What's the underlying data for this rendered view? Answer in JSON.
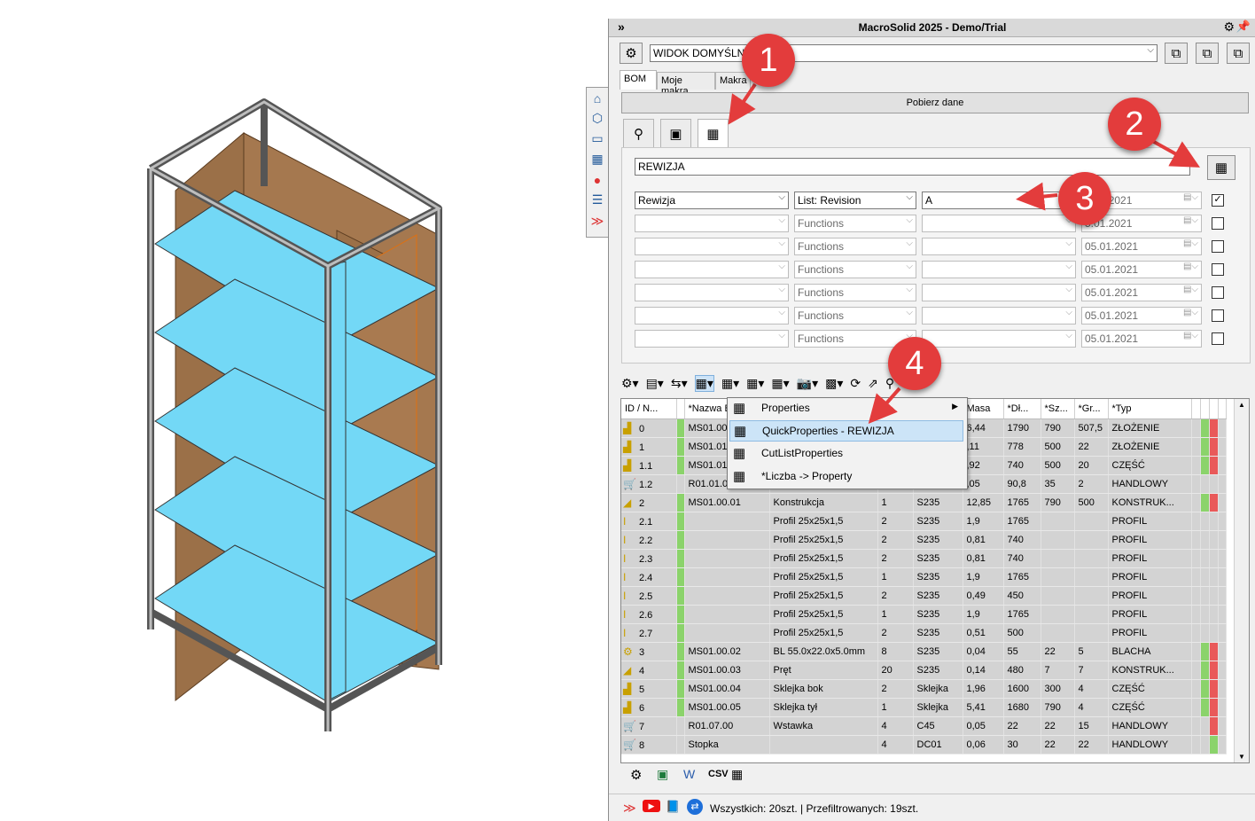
{
  "window": {
    "title": "MacroSolid 2025 - Demo/Trial",
    "collapse_icon": "double-chevron-right-icon"
  },
  "side_toolbar": [
    "home-icon",
    "cube-icon",
    "folder-icon",
    "properties-icon",
    "appearance-icon",
    "list-icon",
    "macrosolid-icon"
  ],
  "view_combo": {
    "value": "WIDOK DOMYŚLNY"
  },
  "tabs": [
    {
      "label": "BOM"
    },
    {
      "label": "Moje makra"
    },
    {
      "label": "Makra"
    }
  ],
  "fetch_button": "Pobierz dane",
  "property_set_combo": {
    "value": "REWIZJA"
  },
  "filter_rows": [
    {
      "name": "Rewizja",
      "func": "List: Revision",
      "value": "A",
      "date": "5.01.2021",
      "checked": true
    },
    {
      "name": "",
      "func": "Functions",
      "value": "",
      "date": "5.01.2021",
      "checked": false
    },
    {
      "name": "",
      "func": "Functions",
      "value": "",
      "date": "05.01.2021",
      "checked": false
    },
    {
      "name": "",
      "func": "Functions",
      "value": "",
      "date": "05.01.2021",
      "checked": false
    },
    {
      "name": "",
      "func": "Functions",
      "value": "",
      "date": "05.01.2021",
      "checked": false
    },
    {
      "name": "",
      "func": "Functions",
      "value": "",
      "date": "05.01.2021",
      "checked": false
    },
    {
      "name": "",
      "func": "Functions",
      "value": "",
      "date": "05.01.2021",
      "checked": false
    }
  ],
  "table": {
    "headers": [
      "ID / N...",
      "*Nazwa B",
      "",
      "",
      "",
      "Masa",
      "*Dł...",
      "*Sz...",
      "*Gr...",
      "*Typ"
    ],
    "rows": [
      {
        "icon": "assembly-icon",
        "id": "0",
        "green": true,
        "name": "MS01.00.0",
        "desc": "",
        "qty": "",
        "mat": "",
        "mass": "6,44",
        "len": "1790",
        "wid": "790",
        "thk": "507,5",
        "type": "ZŁOŻENIE",
        "s1": "g",
        "s2": "r"
      },
      {
        "icon": "assembly-icon",
        "id": "1",
        "green": true,
        "name": "MS01.01.0",
        "desc": "",
        "qty": "",
        "mat": "",
        "mass": ",11",
        "len": "778",
        "wid": "500",
        "thk": "22",
        "type": "ZŁOŻENIE",
        "s1": "g",
        "s2": "r"
      },
      {
        "icon": "part-icon",
        "id": "1.1",
        "green": true,
        "name": "MS01.01.0",
        "desc": "",
        "qty": "",
        "mat": "",
        "mass": ",92",
        "len": "740",
        "wid": "500",
        "thk": "20",
        "type": "CZĘŚĆ",
        "s1": "g",
        "s2": "r"
      },
      {
        "icon": "cart-icon",
        "id": "1.2",
        "green": false,
        "name": "R01.01.02",
        "desc": "",
        "qty": "",
        "mat": "",
        "mass": ",05",
        "len": "90,8",
        "wid": "35",
        "thk": "2",
        "type": "HANDLOWY",
        "s1": "e",
        "s2": "e"
      },
      {
        "icon": "weldment-icon",
        "id": "2",
        "green": true,
        "name": "MS01.00.01",
        "desc": "Konstrukcja",
        "qty": "1",
        "mat": "S235",
        "mass": "12,85",
        "len": "1765",
        "wid": "790",
        "thk": "500",
        "type": "KONSTRUK...",
        "s1": "g",
        "s2": "r"
      },
      {
        "icon": "profile-icon",
        "id": "2.1",
        "green": true,
        "name": "",
        "desc": "Profil 25x25x1,5",
        "qty": "2",
        "mat": "S235",
        "mass": "1,9",
        "len": "1765",
        "wid": "",
        "thk": "",
        "type": "PROFIL",
        "s1": "e",
        "s2": "e"
      },
      {
        "icon": "profile-icon",
        "id": "2.2",
        "green": true,
        "name": "",
        "desc": "Profil 25x25x1,5",
        "qty": "2",
        "mat": "S235",
        "mass": "0,81",
        "len": "740",
        "wid": "",
        "thk": "",
        "type": "PROFIL",
        "s1": "e",
        "s2": "e"
      },
      {
        "icon": "profile-icon",
        "id": "2.3",
        "green": true,
        "name": "",
        "desc": "Profil 25x25x1,5",
        "qty": "2",
        "mat": "S235",
        "mass": "0,81",
        "len": "740",
        "wid": "",
        "thk": "",
        "type": "PROFIL",
        "s1": "e",
        "s2": "e"
      },
      {
        "icon": "profile-icon",
        "id": "2.4",
        "green": true,
        "name": "",
        "desc": "Profil 25x25x1,5",
        "qty": "1",
        "mat": "S235",
        "mass": "1,9",
        "len": "1765",
        "wid": "",
        "thk": "",
        "type": "PROFIL",
        "s1": "e",
        "s2": "e"
      },
      {
        "icon": "profile-icon",
        "id": "2.5",
        "green": true,
        "name": "",
        "desc": "Profil 25x25x1,5",
        "qty": "2",
        "mat": "S235",
        "mass": "0,49",
        "len": "450",
        "wid": "",
        "thk": "",
        "type": "PROFIL",
        "s1": "e",
        "s2": "e"
      },
      {
        "icon": "profile-icon",
        "id": "2.6",
        "green": true,
        "name": "",
        "desc": "Profil 25x25x1,5",
        "qty": "1",
        "mat": "S235",
        "mass": "1,9",
        "len": "1765",
        "wid": "",
        "thk": "",
        "type": "PROFIL",
        "s1": "e",
        "s2": "e"
      },
      {
        "icon": "profile-icon",
        "id": "2.7",
        "green": true,
        "name": "",
        "desc": "Profil 25x25x1,5",
        "qty": "2",
        "mat": "S235",
        "mass": "0,51",
        "len": "500",
        "wid": "",
        "thk": "",
        "type": "PROFIL",
        "s1": "e",
        "s2": "e"
      },
      {
        "icon": "sheetmetal-icon",
        "id": "3",
        "green": true,
        "name": "MS01.00.02",
        "desc": "BL 55.0x22.0x5.0mm",
        "qty": "8",
        "mat": "S235",
        "mass": "0,04",
        "len": "55",
        "wid": "22",
        "thk": "5",
        "type": "BLACHA",
        "s1": "g",
        "s2": "r"
      },
      {
        "icon": "weldment-icon",
        "id": "4",
        "green": true,
        "name": "MS01.00.03",
        "desc": "Pręt",
        "qty": "20",
        "mat": "S235",
        "mass": "0,14",
        "len": "480",
        "wid": "7",
        "thk": "7",
        "type": "KONSTRUK...",
        "s1": "g",
        "s2": "r"
      },
      {
        "icon": "part-icon",
        "id": "5",
        "green": true,
        "name": "MS01.00.04",
        "desc": "Sklejka bok",
        "qty": "2",
        "mat": "Sklejka",
        "mass": "1,96",
        "len": "1600",
        "wid": "300",
        "thk": "4",
        "type": "CZĘŚĆ",
        "s1": "g",
        "s2": "r"
      },
      {
        "icon": "part-icon",
        "id": "6",
        "green": true,
        "name": "MS01.00.05",
        "desc": "Sklejka tył",
        "qty": "1",
        "mat": "Sklejka",
        "mass": "5,41",
        "len": "1680",
        "wid": "790",
        "thk": "4",
        "type": "CZĘŚĆ",
        "s1": "g",
        "s2": "r"
      },
      {
        "icon": "cart-icon",
        "id": "7",
        "green": false,
        "name": "R01.07.00",
        "desc": "Wstawka",
        "qty": "4",
        "mat": "C45",
        "mass": "0,05",
        "len": "22",
        "wid": "22",
        "thk": "15",
        "type": "HANDLOWY",
        "s1": "e",
        "s2": "r"
      },
      {
        "icon": "cart-icon",
        "id": "8",
        "green": false,
        "name": "Stopka",
        "desc": "",
        "qty": "4",
        "mat": "DC01",
        "mass": "0,06",
        "len": "30",
        "wid": "22",
        "thk": "22",
        "type": "HANDLOWY",
        "s1": "e",
        "s2": "g"
      }
    ]
  },
  "context_menu": [
    {
      "label": "Properties",
      "icon": "properties-icon",
      "submenu": true,
      "highlighted": false
    },
    {
      "label": "QuickProperties - REWIZJA",
      "icon": "quick-properties-icon",
      "submenu": false,
      "highlighted": true
    },
    {
      "label": "CutListProperties",
      "icon": "cutlist-icon",
      "submenu": false,
      "highlighted": false
    },
    {
      "label": "*Liczba -> Property",
      "icon": "number-property-icon",
      "submenu": false,
      "highlighted": false
    }
  ],
  "export_buttons": {
    "csv_label": "CSV"
  },
  "status": {
    "text": "Wszystkich: 20szt. | Przefiltrowanych: 19szt."
  },
  "callouts": [
    "1",
    "2",
    "3",
    "4"
  ],
  "colors": {
    "callout": "#e33c3c",
    "ok_green": "#8bd36b",
    "error_red": "#e95959",
    "shelf_blue": "#72d9f7",
    "panel_wood": "#9b7048"
  }
}
